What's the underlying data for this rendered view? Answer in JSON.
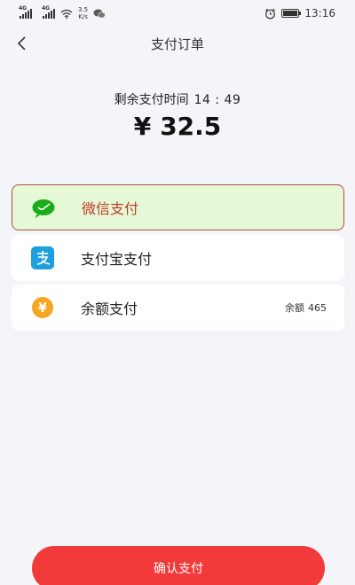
{
  "status_bar": {
    "network_type_1": "4G",
    "network_type_2": "4G",
    "net_speed_value": "3.5",
    "net_speed_unit": "K/s",
    "time": "13:16"
  },
  "nav": {
    "title": "支付订单"
  },
  "payment": {
    "timer_label": "剩余支付时间",
    "timer_value": "14 : 49",
    "currency_symbol": "¥",
    "amount": "32.5"
  },
  "methods": [
    {
      "label": "微信支付",
      "icon": "wechat-icon",
      "icon_color": "#1aad19",
      "selected": true
    },
    {
      "label": "支付宝支付",
      "icon": "alipay-icon",
      "icon_color": "#1fa0de",
      "selected": false
    },
    {
      "label": "余额支付",
      "icon": "balance-yen-icon",
      "icon_color": "#f5a623",
      "selected": false,
      "extra_label": "余额",
      "extra_value": "465"
    }
  ],
  "confirm_label": "确认支付",
  "colors": {
    "selected_bg": "#e5f9d6",
    "selected_border": "#b8494a",
    "confirm_button": "#f23a3a",
    "page_bg": "#f4f5f9"
  }
}
